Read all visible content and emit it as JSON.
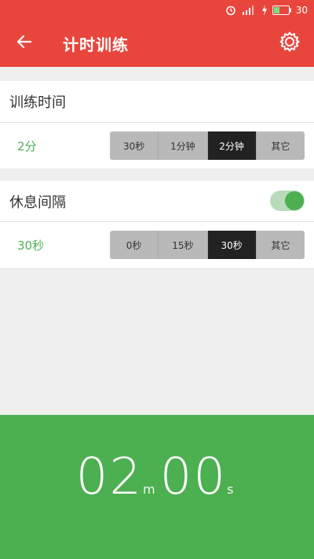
{
  "status_bar": {
    "battery_text": "30",
    "icons": [
      "alarm-icon",
      "signal-icon",
      "charging-icon",
      "battery-icon"
    ]
  },
  "header": {
    "title": "计时训练",
    "back_icon": "arrow-left-icon",
    "settings_icon": "gear-icon"
  },
  "training": {
    "label": "训练时间",
    "value": "2分",
    "options": [
      "30秒",
      "1分钟",
      "2分钟",
      "其它"
    ],
    "selected_index": 2
  },
  "rest": {
    "label": "休息间隔",
    "enabled": true,
    "value": "30秒",
    "options": [
      "0秒",
      "15秒",
      "30秒",
      "其它"
    ],
    "selected_index": 2
  },
  "timer": {
    "minutes": "02",
    "minutes_unit": "m",
    "seconds": "00",
    "seconds_unit": "s"
  },
  "colors": {
    "header_red": "#e8463d",
    "accent_green": "#4caf50",
    "active_segment": "#222222"
  }
}
